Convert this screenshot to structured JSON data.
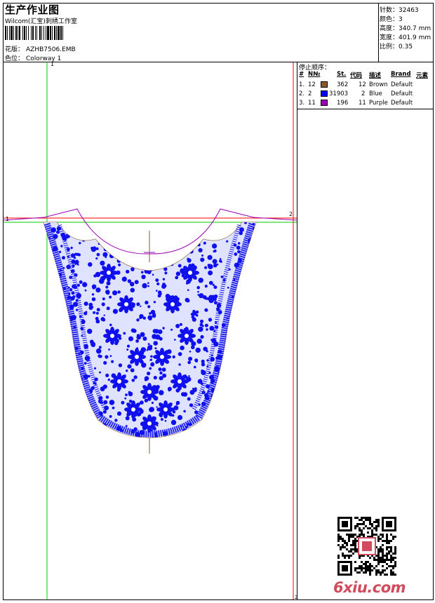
{
  "header": {
    "title": "生产作业图",
    "studio": "Wilcom(汇宝)刺绣工作室",
    "design_label": "花版：",
    "design_value": "AZHB7506.EMB",
    "colorway_label": "色位：",
    "colorway_value": "Colorway 1"
  },
  "specs": [
    {
      "label": "针数：",
      "value": "32463"
    },
    {
      "label": "颜色：",
      "value": "3"
    },
    {
      "label": "高度：",
      "value": "340.7 mm"
    },
    {
      "label": "宽度：",
      "value": "401.9 mm"
    },
    {
      "label": "比例：",
      "value": "0.35"
    }
  ],
  "stop_sequence": {
    "title": "停止顺序：",
    "headers": {
      "num": "#",
      "no": "N№",
      "st": "St.",
      "code": "代码",
      "desc": "描述",
      "brand": "Brand",
      "element": "元素"
    },
    "rows": [
      {
        "idx": "1.",
        "no": "12",
        "color": "#8b5a2b",
        "st": "362",
        "code": "12",
        "desc": "Brown",
        "brand": "Default"
      },
      {
        "idx": "2.",
        "no": "2",
        "color": "#0000ff",
        "st": "31903",
        "code": "2",
        "desc": "Blue",
        "brand": "Default"
      },
      {
        "idx": "3.",
        "no": "11",
        "color": "#9b00b5",
        "st": "196",
        "code": "11",
        "desc": "Purple",
        "brand": "Default"
      }
    ]
  },
  "markers": {
    "m1_top": "1",
    "m1_left": "1",
    "m2_right": "2",
    "m2_bottom": "2"
  },
  "watermark": {
    "logo": "6xiu.com"
  },
  "colors": {
    "guide": "#00cc00",
    "guide2": "#ff0000",
    "stitch": "#1010ee",
    "outline": "#8b5a2b",
    "neck": "#9b00b5"
  }
}
